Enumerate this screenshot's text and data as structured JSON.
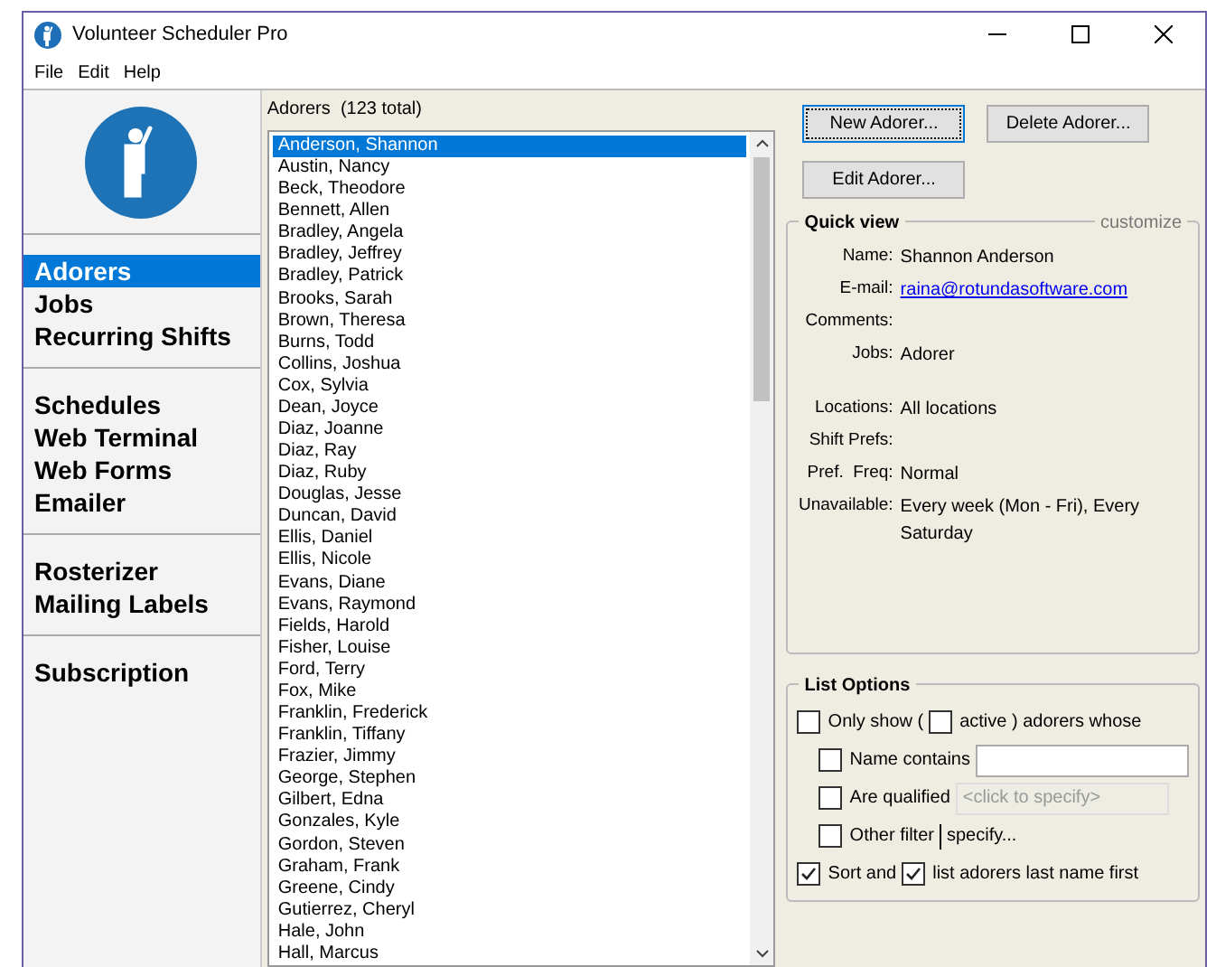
{
  "window": {
    "title": "Volunteer Scheduler Pro"
  },
  "menu": [
    "File",
    "Edit",
    "Help"
  ],
  "nav_groups": [
    [
      {
        "label": "Adorers",
        "selected": true
      },
      {
        "label": "Jobs",
        "selected": false
      },
      {
        "label": "Recurring Shifts",
        "selected": false
      }
    ],
    [
      {
        "label": "Schedules",
        "selected": false
      },
      {
        "label": "Web Terminal",
        "selected": false
      },
      {
        "label": "Web Forms",
        "selected": false
      },
      {
        "label": "Emailer",
        "selected": false
      }
    ],
    [
      {
        "label": "Rosterizer",
        "selected": false
      },
      {
        "label": "Mailing Labels",
        "selected": false
      }
    ],
    [
      {
        "label": "Subscription",
        "selected": false
      }
    ]
  ],
  "list": {
    "title": "Adorers  (123 total)",
    "items": [
      {
        "label": "Anderson, Shannon",
        "selected": true
      },
      {
        "label": "Austin, Nancy",
        "selected": false
      },
      {
        "label": "Beck, Theodore",
        "selected": false
      },
      {
        "label": "Bennett, Allen",
        "selected": false
      },
      {
        "label": "Bradley, Angela",
        "selected": false
      },
      {
        "label": "Bradley, Jeffrey",
        "selected": false
      },
      {
        "label": "Bradley, Patrick",
        "selected": false
      },
      {
        "label": "Brooks, Sarah",
        "selected": false
      },
      {
        "label": "Brown, Theresa",
        "selected": false
      },
      {
        "label": "Burns, Todd",
        "selected": false
      },
      {
        "label": "Collins, Joshua",
        "selected": false
      },
      {
        "label": "Cox, Sylvia",
        "selected": false
      },
      {
        "label": "Dean, Joyce",
        "selected": false
      },
      {
        "label": "Diaz, Joanne",
        "selected": false
      },
      {
        "label": "Diaz, Ray",
        "selected": false
      },
      {
        "label": "Diaz, Ruby",
        "selected": false
      },
      {
        "label": "Douglas, Jesse",
        "selected": false
      },
      {
        "label": "Duncan, David",
        "selected": false
      },
      {
        "label": "Ellis, Daniel",
        "selected": false
      },
      {
        "label": "Ellis, Nicole",
        "selected": false
      },
      {
        "label": "Evans, Diane",
        "selected": false
      },
      {
        "label": "Evans, Raymond",
        "selected": false
      },
      {
        "label": "Fields, Harold",
        "selected": false
      },
      {
        "label": "Fisher, Louise",
        "selected": false
      },
      {
        "label": "Ford, Terry",
        "selected": false
      },
      {
        "label": "Fox, Mike",
        "selected": false
      },
      {
        "label": "Franklin, Frederick",
        "selected": false
      },
      {
        "label": "Franklin, Tiffany",
        "selected": false
      },
      {
        "label": "Frazier, Jimmy",
        "selected": false
      },
      {
        "label": "George, Stephen",
        "selected": false
      },
      {
        "label": "Gilbert, Edna",
        "selected": false
      },
      {
        "label": "Gonzales, Kyle",
        "selected": false
      },
      {
        "label": "Gordon, Steven",
        "selected": false
      },
      {
        "label": "Graham, Frank",
        "selected": false
      },
      {
        "label": "Greene, Cindy",
        "selected": false
      },
      {
        "label": "Gutierrez, Cheryl",
        "selected": false
      },
      {
        "label": "Hale, John",
        "selected": false
      },
      {
        "label": "Hall, Marcus",
        "selected": false
      }
    ]
  },
  "buttons": [
    {
      "label": "New Adorer...",
      "focused": true
    },
    {
      "label": "Delete Adorer...",
      "focused": false
    },
    {
      "label": "Edit Adorer...",
      "focused": false
    }
  ],
  "quick_view": {
    "title": "Quick view",
    "action": "customize",
    "fields": [
      {
        "label": "Name:",
        "value": "Shannon Anderson",
        "kind": "text"
      },
      {
        "label": "E-mail:",
        "value": "raina@rotundasoftware.com",
        "kind": "link"
      },
      {
        "label": "Comments:",
        "kind": "text"
      },
      {
        "label": "Jobs:",
        "value": "Adorer",
        "kind": "text"
      },
      {
        "kind": "gap"
      },
      {
        "label": "Locations:",
        "value": "All locations",
        "kind": "text"
      },
      {
        "label": "Shift Prefs:",
        "kind": "text"
      },
      {
        "label": "Pref.  Freq:",
        "value": "Normal",
        "kind": "text"
      },
      {
        "label": "Unavailable:",
        "value": "Every week (Mon - Fri), Every Saturday",
        "kind": "text"
      }
    ]
  },
  "list_options": {
    "title": "List Options",
    "rows": [
      {
        "parts": [
          {
            "kind": "checkbox",
            "label": "Only show (",
            "checked": false
          },
          {
            "kind": "checkbox",
            "label": "active ) adorers whose",
            "checked": false
          }
        ],
        "children": [
          {
            "parts": [
              {
                "kind": "checkbox",
                "label": "Name contains",
                "checked": false
              },
              {
                "kind": "field"
              }
            ]
          },
          {
            "parts": [
              {
                "kind": "checkbox",
                "label": "Are qualified",
                "checked": false
              },
              {
                "kind": "field",
                "placeholder": "<click to specify>",
                "disabled": true
              }
            ]
          },
          {
            "parts": [
              {
                "kind": "checkbox",
                "label": "Other filter",
                "checked": false
              },
              {
                "kind": "link",
                "label": "specify..."
              }
            ]
          }
        ]
      },
      {
        "parts": [
          {
            "kind": "checkbox",
            "label": "Sort and",
            "checked": true
          },
          {
            "kind": "checkbox",
            "label": "list adorers last name first",
            "checked": true
          }
        ]
      }
    ]
  }
}
